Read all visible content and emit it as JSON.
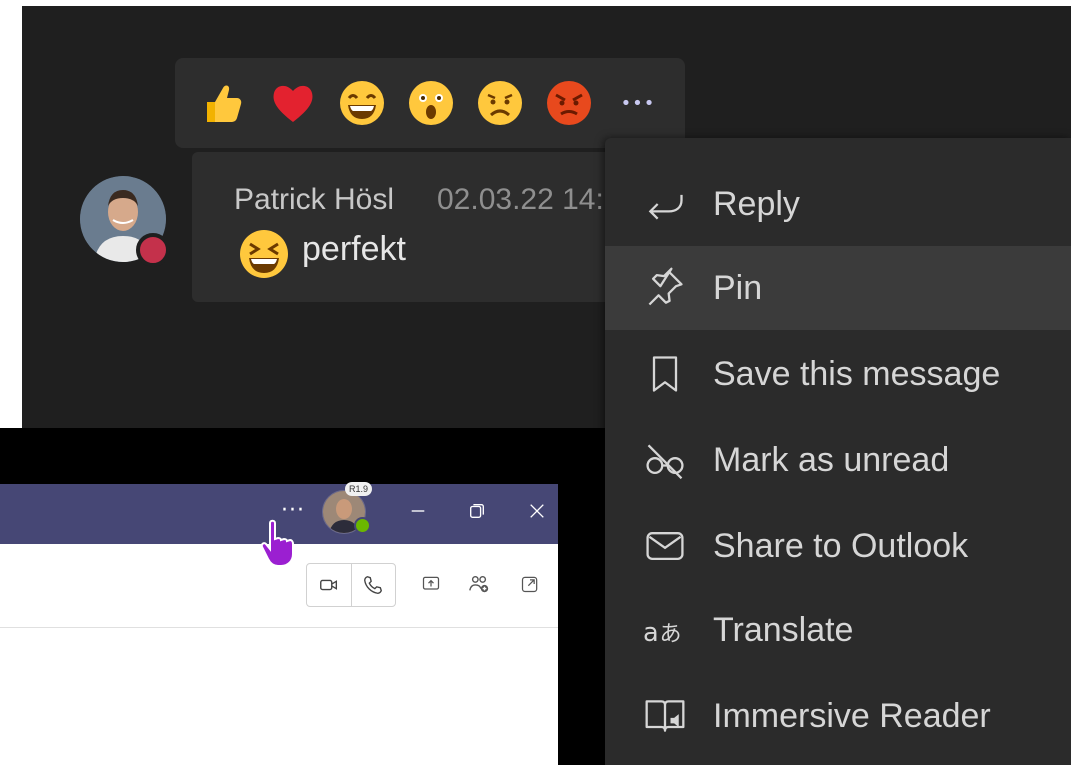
{
  "reactions": [
    {
      "name": "like",
      "icon": "thumbs-up-icon"
    },
    {
      "name": "heart",
      "icon": "heart-icon"
    },
    {
      "name": "laugh",
      "icon": "laugh-icon"
    },
    {
      "name": "surprised",
      "icon": "surprised-icon"
    },
    {
      "name": "sad",
      "icon": "sad-icon"
    },
    {
      "name": "angry",
      "icon": "angry-icon"
    }
  ],
  "more_reactions_label": "•••",
  "message": {
    "sender": "Patrick Hösl",
    "timestamp": "02.03.22 14:",
    "text": "perfekt",
    "emoji_icon": "grinning-squint-icon"
  },
  "context_menu": {
    "items": [
      {
        "label": "Reply",
        "icon": "reply-icon"
      },
      {
        "label": "Pin",
        "icon": "pin-icon",
        "hovered": true
      },
      {
        "label": "Save this message",
        "icon": "bookmark-icon"
      },
      {
        "label": "Mark as unread",
        "icon": "unread-glasses-icon"
      },
      {
        "label": "Share to Outlook",
        "icon": "envelope-icon"
      },
      {
        "label": "Translate",
        "icon": "translate-icon"
      },
      {
        "label": "Immersive Reader",
        "icon": "immersive-reader-icon"
      }
    ]
  },
  "titlebar": {
    "more_label": "···",
    "avatar_badge": "R1.9"
  },
  "colors": {
    "chat_background": "#1f1f1f",
    "menu_background": "#2b2b2b",
    "titlebar_purple": "#464775",
    "status_busy": "#c4314b",
    "status_available": "#6bb700"
  }
}
